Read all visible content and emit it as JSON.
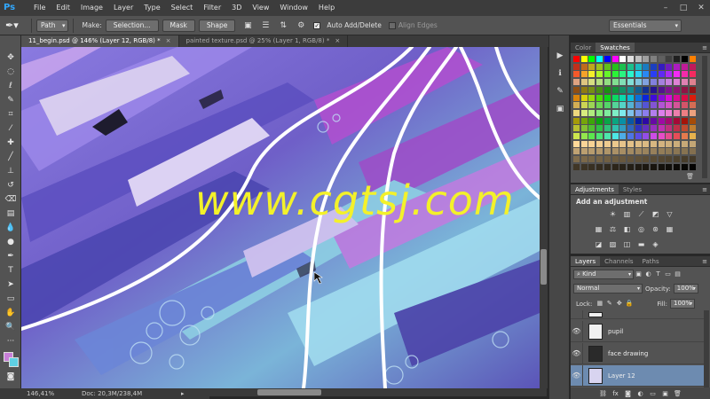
{
  "app": {
    "logo": "Ps"
  },
  "menu": [
    "File",
    "Edit",
    "Image",
    "Layer",
    "Type",
    "Select",
    "Filter",
    "3D",
    "View",
    "Window",
    "Help"
  ],
  "window_controls": [
    "–",
    "□",
    "✕"
  ],
  "options": {
    "mode": "Path",
    "make_label": "Make:",
    "selection_btn": "Selection...",
    "mask_btn": "Mask",
    "shape_btn": "Shape",
    "auto_add_delete": "Auto Add/Delete",
    "align_edges": "Align Edges",
    "workspace": "Essentials"
  },
  "tabs": [
    {
      "label": "11_begin.psd @ 146% (Layer 12, RGB/8) *",
      "close": "×"
    },
    {
      "label": "painted texture.psd @ 25% (Layer 1, RGB/8) *",
      "close": "×"
    }
  ],
  "canvas": {
    "watermark": "www.cgtsj.com"
  },
  "status": {
    "zoom": "146,41%",
    "doc": "Doc: 20,3M/238,4M",
    "arrow": "▸"
  },
  "colors": {
    "foreground": "#c77ed8",
    "background": "#5fd0e4",
    "accent_selection": "#6d8bb0",
    "watermark": "#f3f12a"
  },
  "swatches_panel": {
    "tabs": [
      "Color",
      "Swatches"
    ],
    "menu": "≡"
  },
  "adjustments_panel": {
    "tabs": [
      "Adjustments",
      "Styles"
    ],
    "title": "Add an adjustment",
    "menu": "≡"
  },
  "layers_panel": {
    "tabs": [
      "Layers",
      "Channels",
      "Paths"
    ],
    "menu": "≡",
    "filter": "Kind",
    "blend_mode": "Normal",
    "opacity_label": "Opacity:",
    "opacity": "100%",
    "lock_label": "Lock:",
    "fill_label": "Fill:",
    "fill": "100%",
    "layers": [
      {
        "name": "pupil"
      },
      {
        "name": "face drawing"
      },
      {
        "name": "Layer 12"
      }
    ]
  }
}
